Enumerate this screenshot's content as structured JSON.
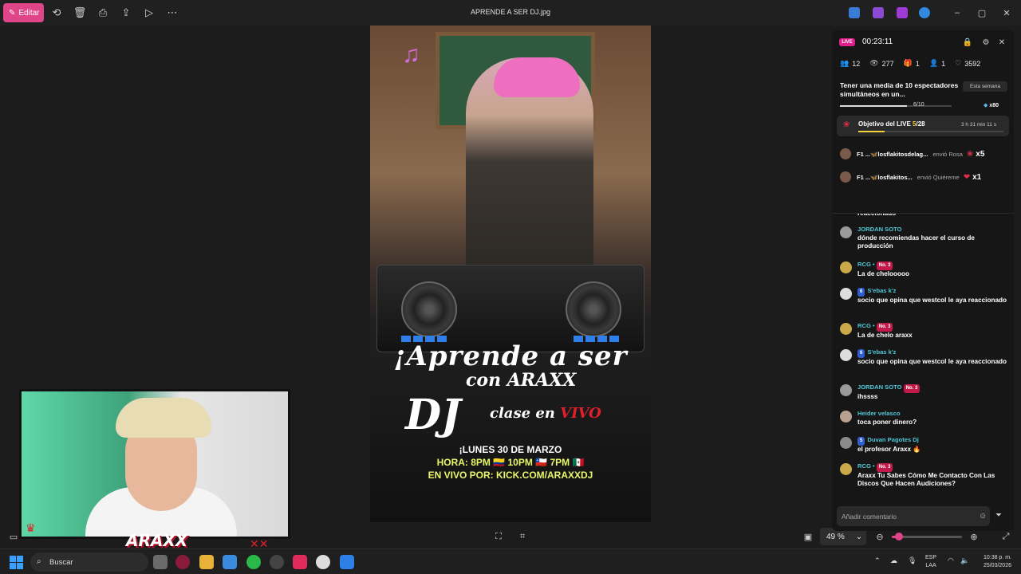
{
  "toolbar": {
    "edit_label": "Editar",
    "file_title": "APRENDE A SER DJ.jpg"
  },
  "poster": {
    "headline_1": "¡Aprende a ser",
    "headline_2": "con ARAXX",
    "headline_3": "DJ",
    "headline_4_prefix": "clase en ",
    "headline_4_live": "VIVO",
    "date_line": "¡LUNES 30 DE MARZO",
    "time_line": "HORA: 8PM 🇨🇴  10PM 🇨🇱  7PM 🇲🇽",
    "url_line": "EN VIVO POR: KICK.COM/ARAXXDJ"
  },
  "webcam": {
    "brand": "ARAXX"
  },
  "viewer": {
    "zoom": "49 %",
    "zoom_level": 0.1
  },
  "live": {
    "badge": "LIVE",
    "timer": "00:23:11",
    "stats": {
      "viewers": "12",
      "views": "277",
      "gifts": "1",
      "follows": "1",
      "likes": "3592"
    },
    "weekly_goal": {
      "text": "Tener una media de 10 espectadores simultáneos en un...",
      "badge": "Esta semana",
      "progress": "6/10",
      "progress_value": 0.6,
      "reward": "x80"
    },
    "objective": {
      "label": "Objetivo del LIVE ",
      "current": "5",
      "total": "/28",
      "progress_value": 0.18,
      "time_left": "3 h 31 min 11 s"
    },
    "gifts": [
      {
        "user": "F1 ...🦋losflakitosdelag...",
        "action": "envió Rosa",
        "icon": "rose-icon",
        "count": "x5"
      },
      {
        "user": "F1 ...🦋losflakitos...",
        "action": "envió Quiéreme",
        "icon": "heart-gift-icon",
        "count": "x1"
      }
    ],
    "chat": [
      {
        "name": "",
        "fan": "",
        "rank": "",
        "text": "reaccionado"
      },
      {
        "name": "JORDAN SOTO",
        "fan": "",
        "rank": "",
        "text": "dónde recomiendas hacer el curso de producción"
      },
      {
        "name": "RCG •",
        "fan": "",
        "rank": "No. 3",
        "text": "La de chelooooo"
      },
      {
        "name": "S'ebas k'z",
        "fan": "6",
        "rank": "",
        "text": "socio que opina que westcol le aya reaccionado"
      },
      {
        "name": "RCG •",
        "fan": "",
        "rank": "No. 3",
        "text": "La de chelo araxx"
      },
      {
        "name": "S'ebas k'z",
        "fan": "6",
        "rank": "",
        "text": "socio que opina que westcol le aya reaccionado"
      },
      {
        "name": "JORDAN SOTO",
        "fan": "",
        "rank": "No. 3",
        "text": "ihssss"
      },
      {
        "name": "Heider velasco",
        "fan": "",
        "rank": "",
        "text": "toca poner dinero?"
      },
      {
        "name": "Duvan Pagotes Dj",
        "fan": "5",
        "rank": "",
        "text": "el profesor Araxx 🔥"
      },
      {
        "name": "RCG •",
        "fan": "",
        "rank": "No. 3",
        "text": "Araxx Tu Sabes Cómo Me Contacto Con Las Discos Que Hacen Audiciones?"
      }
    ],
    "comment_placeholder": "Añadir comentario"
  },
  "taskbar": {
    "search_label": "Buscar",
    "lang_1": "ESP",
    "lang_2": "LAA",
    "time": "10:38 p. m.",
    "date": "25/03/2026"
  },
  "colors": {
    "accent": "#e0458a",
    "chat_name": "#4fc7d8",
    "live": "#e0208a"
  }
}
